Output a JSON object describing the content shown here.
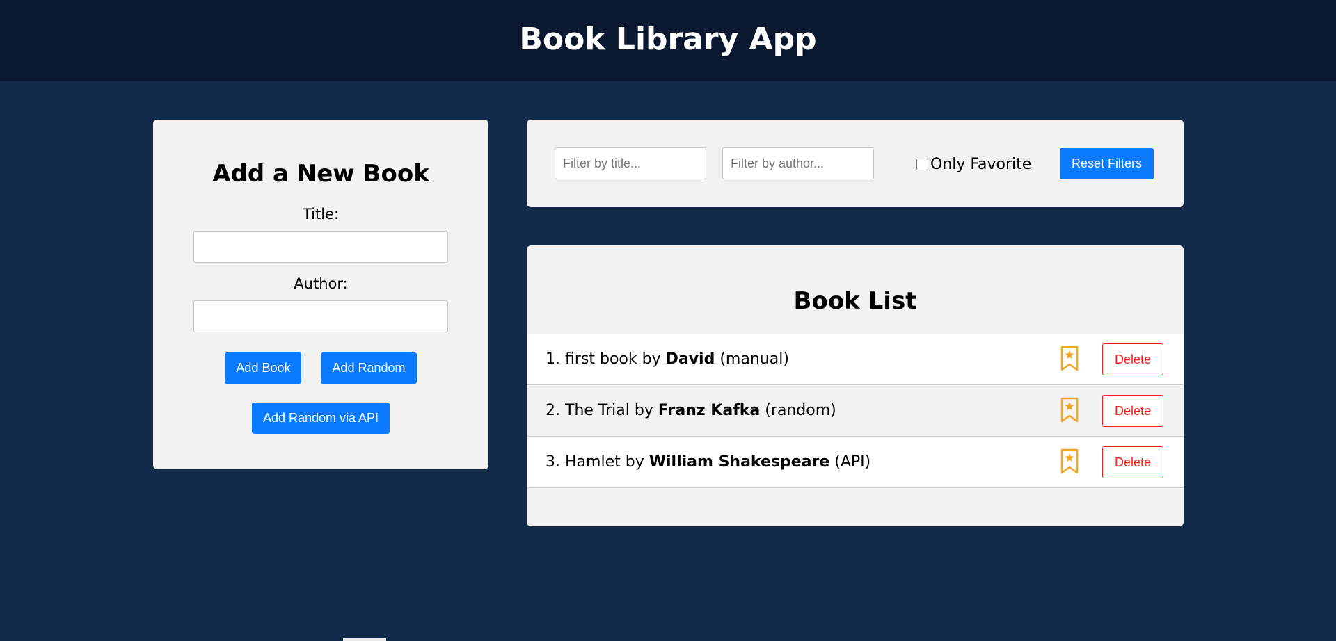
{
  "app": {
    "title": "Book Library App"
  },
  "add_form": {
    "heading": "Add a New Book",
    "title_label": "Title:",
    "title_value": "",
    "author_label": "Author:",
    "author_value": "",
    "add_book_label": "Add Book",
    "add_random_label": "Add Random",
    "add_api_label": "Add Random via API"
  },
  "filters": {
    "title_placeholder": "Filter by title...",
    "author_placeholder": "Filter by author...",
    "only_favorite_label": "Only Favorite",
    "only_favorite_checked": false,
    "reset_label": "Reset Filters"
  },
  "book_list": {
    "heading": "Book List",
    "items": [
      {
        "index": "1.",
        "title": "first book",
        "by": "by",
        "author": "David",
        "source": "(manual)",
        "favorite": false,
        "delete_label": "Delete"
      },
      {
        "index": "2.",
        "title": "The Trial",
        "by": "by",
        "author": "Franz Kafka",
        "source": "(random)",
        "favorite": false,
        "delete_label": "Delete"
      },
      {
        "index": "3.",
        "title": "Hamlet",
        "by": "by",
        "author": "William Shakespeare",
        "source": "(API)",
        "favorite": false,
        "delete_label": "Delete"
      }
    ]
  },
  "colors": {
    "header_bg": "#0a192f",
    "page_bg": "#132b4b",
    "panel_bg": "#f2f2f2",
    "primary": "#0a7bff",
    "danger": "#ff1a1a",
    "favorite": "#f5a623"
  },
  "icons": {
    "favorite": "bookmark-star-icon"
  }
}
